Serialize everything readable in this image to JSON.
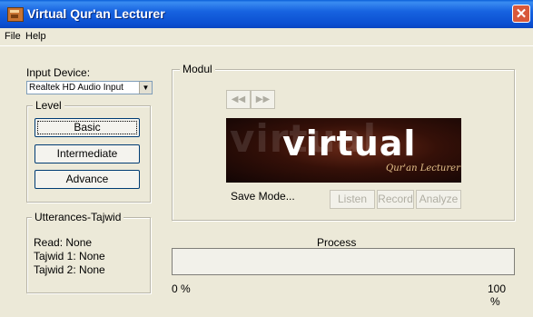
{
  "window": {
    "title": "Virtual Qur'an Lecturer"
  },
  "menu": {
    "items": [
      "File",
      "Help"
    ]
  },
  "input_device": {
    "label": "Input Device:",
    "value": "Realtek HD Audio Input"
  },
  "level": {
    "legend": "Level",
    "buttons": [
      "Basic",
      "Intermediate",
      "Advance"
    ]
  },
  "utterances": {
    "legend": "Utterances-Tajwid",
    "read": "Read: None",
    "tajwid1": "Tajwid 1: None",
    "tajwid2": "Tajwid 2: None"
  },
  "modul": {
    "legend": "Modul",
    "back_glyph": "◀◀",
    "forward_glyph": "▶▶",
    "banner_ghost": "virtual",
    "banner_main": "virtual",
    "banner_sub": "Qur'an Lecturer",
    "save_mode": "Save Mode...",
    "listen": "Listen",
    "record": "Record",
    "analyze": "Analyze"
  },
  "process": {
    "label": "Process",
    "min": "0 %",
    "max_value": "100",
    "max_unit": "%",
    "progress": 0
  },
  "colors": {
    "title_bar": "#0b4fd1",
    "window_bg": "#ece9d8",
    "close": "#d8583a"
  }
}
